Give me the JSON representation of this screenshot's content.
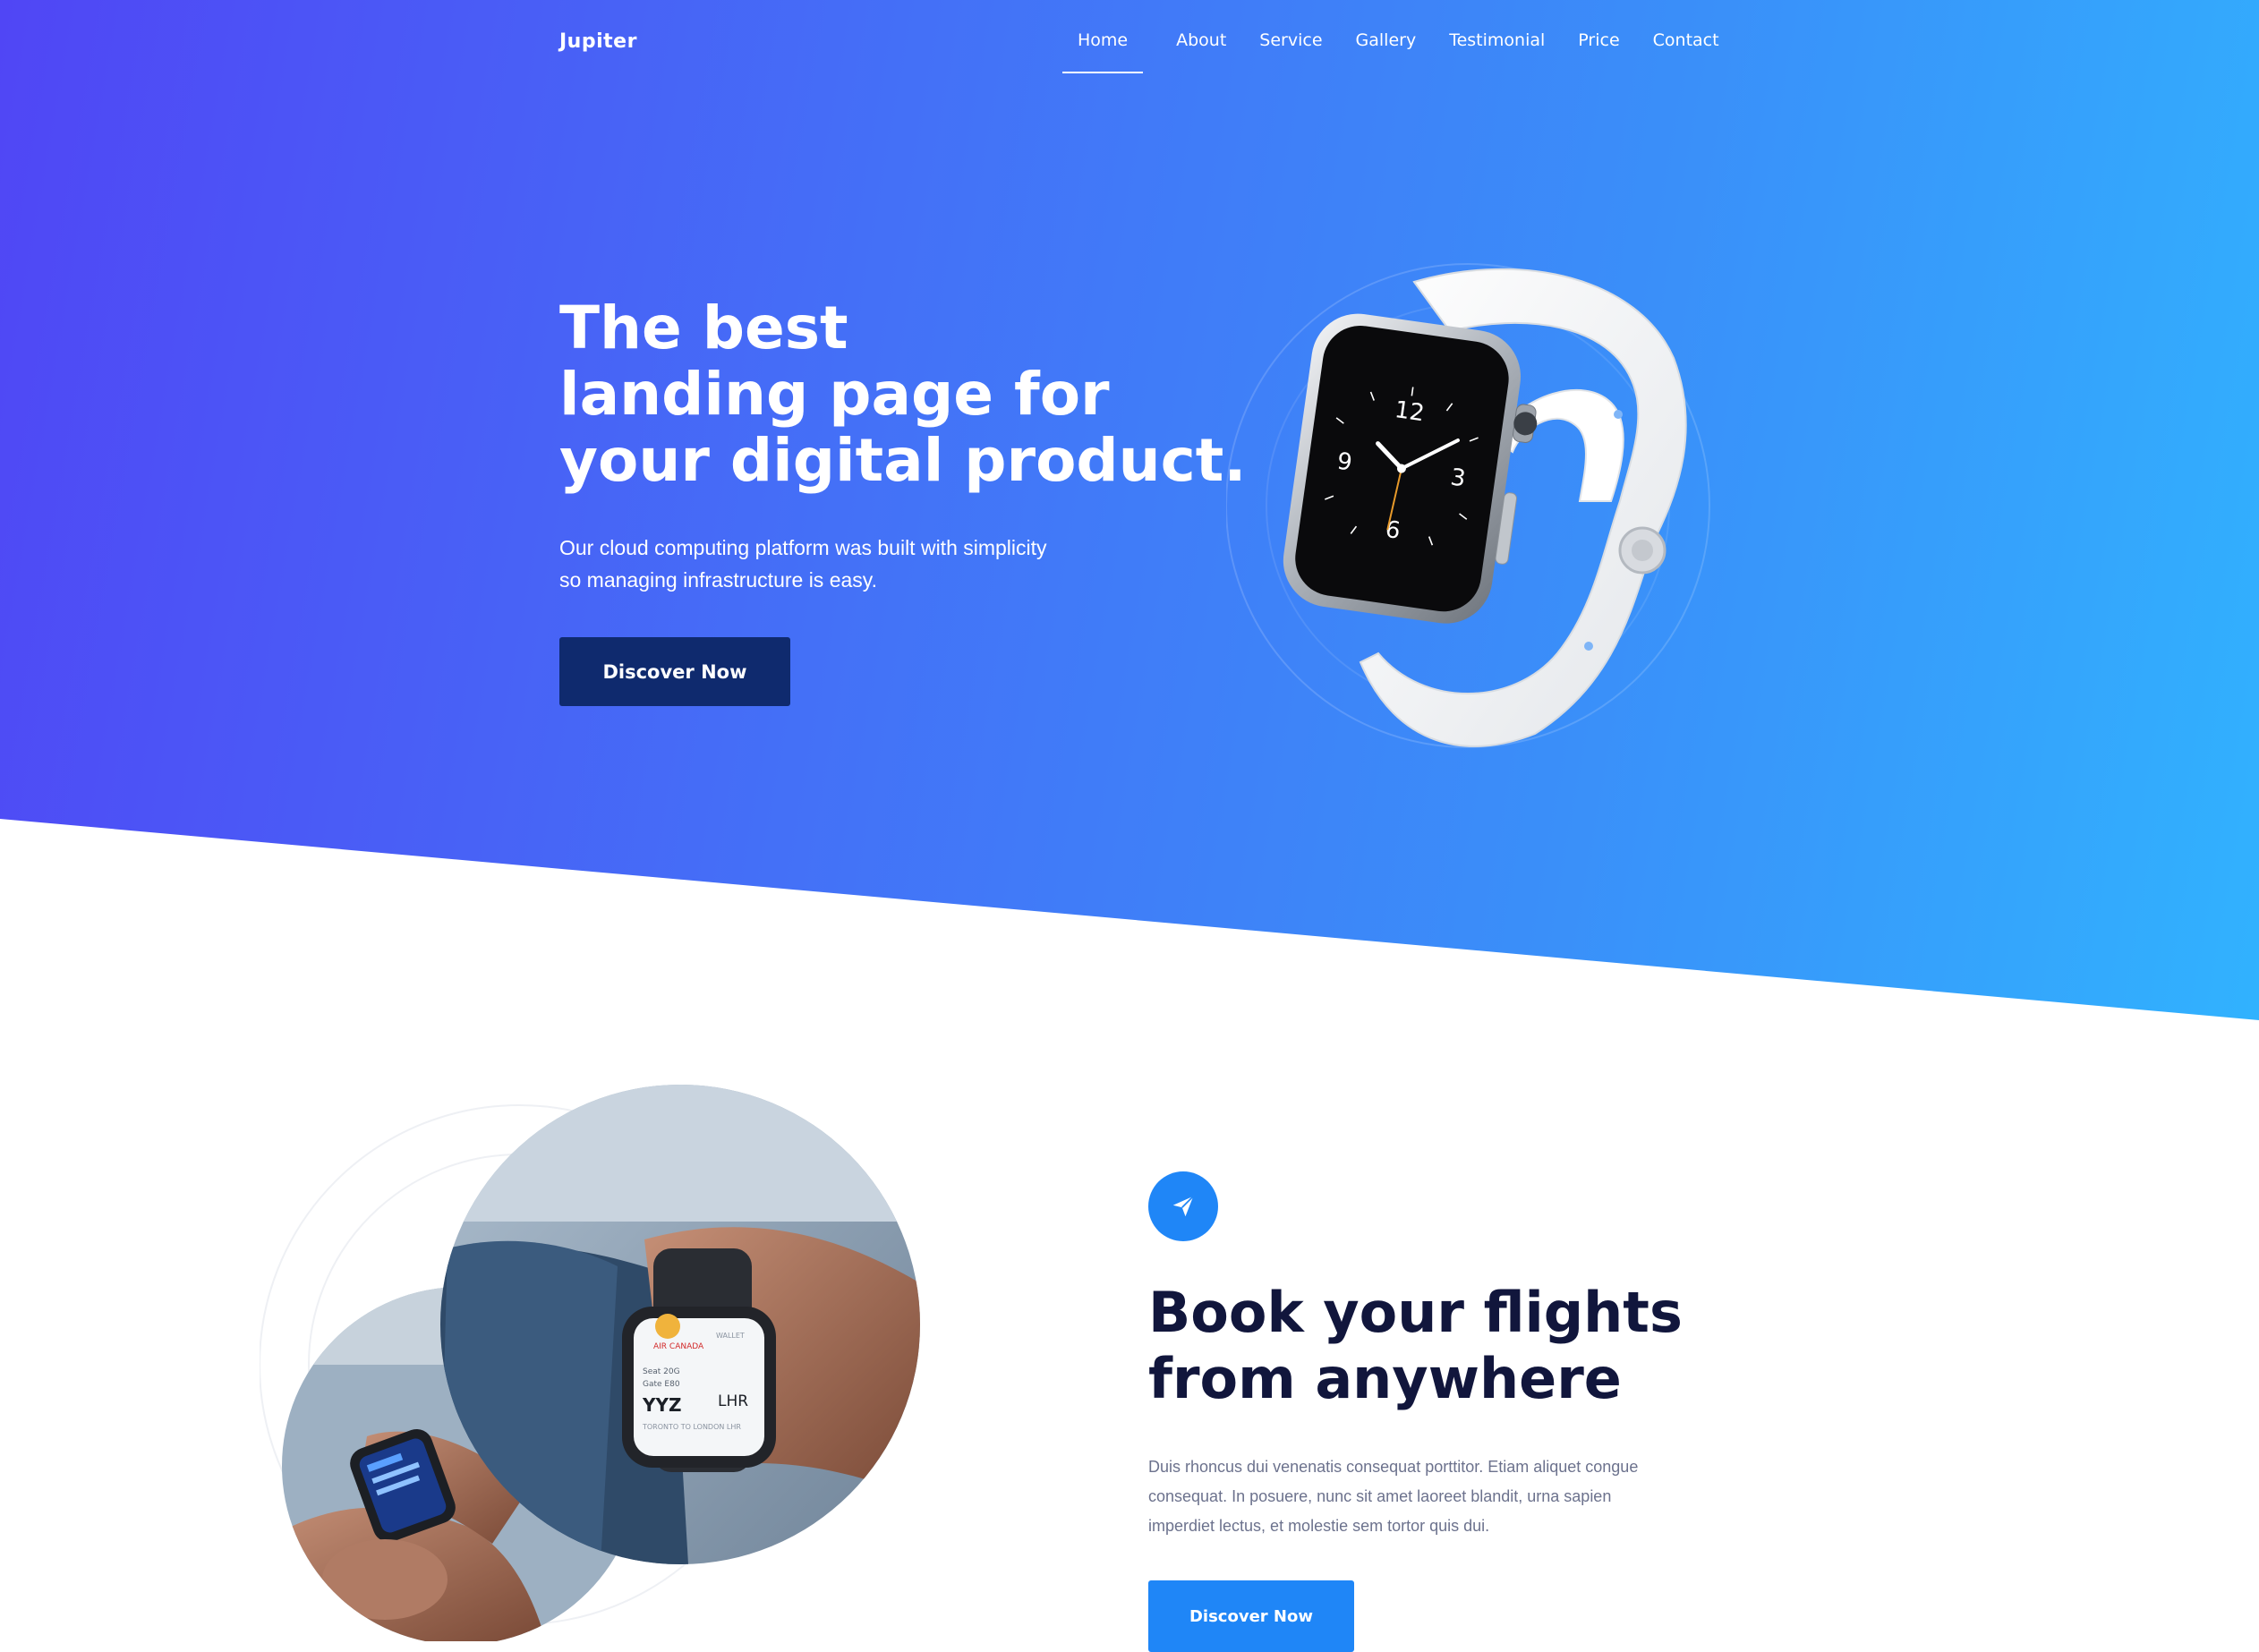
{
  "header": {
    "brand": "Jupiter",
    "nav": [
      "Home",
      "About",
      "Service",
      "Gallery",
      "Testimonial",
      "Price",
      "Contact"
    ],
    "active": "Home"
  },
  "hero": {
    "title_lines": [
      "The best",
      "landing page for",
      "your digital product."
    ],
    "subtitle_lines": [
      "Our cloud computing platform was built with simplicity",
      "so managing infrastructure is easy."
    ],
    "cta": "Discover Now",
    "watch": {
      "numerals": [
        "12",
        "3",
        "6",
        "9"
      ]
    }
  },
  "feature": {
    "icon": "paper-plane-icon",
    "title_lines": [
      "Book your flights",
      "from anywhere"
    ],
    "text_lines": [
      "Duis rhoncus dui venenatis consequat porttitor. Etiam aliquet congue",
      "consequat. In posuere, nunc sit amet laoreet blandit, urna sapien",
      "imperdiet lectus, et molestie sem tortor quis dui."
    ],
    "cta": "Discover Now",
    "watch_screen": {
      "airline": "AIR CANADA",
      "wallet": "WALLET",
      "seat": "Seat 20G",
      "gate": "Gate E80",
      "from": "YYZ",
      "to": "LHR",
      "route": "TORONTO TO LONDON LHR"
    }
  },
  "colors": {
    "hero_gradient_start": "#5046f5",
    "hero_gradient_end": "#31b2fe",
    "dark_button": "#0f2a6e",
    "accent_blue": "#1f86f7",
    "heading_dark": "#11163c"
  }
}
